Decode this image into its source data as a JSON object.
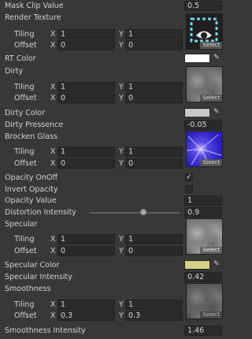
{
  "mask_clip": {
    "label": "Mask Clip Value",
    "value": "0.5"
  },
  "render_texture": {
    "label": "Render Texture",
    "tiling": {
      "label": "Tiling",
      "x": "1",
      "y": "1"
    },
    "offset": {
      "label": "Offset",
      "x": "0",
      "y": "0"
    },
    "select": "Select"
  },
  "rt_color": {
    "label": "RT Color",
    "color": "#ffffff"
  },
  "dirty": {
    "label": "Dirty",
    "tiling": {
      "label": "Tiling",
      "x": "1",
      "y": "1"
    },
    "offset": {
      "label": "Offset",
      "x": "0",
      "y": "0"
    },
    "select": "Select"
  },
  "dirty_color": {
    "label": "Dirty Color",
    "color": "#c8c8c8"
  },
  "dirty_presence": {
    "label": "Dirty Pressence",
    "value": "-0.05"
  },
  "broken_glass": {
    "label": "Brocken Glass",
    "tiling": {
      "label": "Tiling",
      "x": "1",
      "y": "1"
    },
    "offset": {
      "label": "Offset",
      "x": "0",
      "y": "0"
    },
    "select": "Select"
  },
  "opacity_onoff": {
    "label": "Opacity OnOff",
    "checked": true,
    "mark": "✓"
  },
  "invert_opacity": {
    "label": "Invert Opacity",
    "checked": false
  },
  "opacity_value": {
    "label": "Opacity Value",
    "value": "1"
  },
  "distortion": {
    "label": "Distortion Intensity",
    "value": "0.9",
    "slider_fraction": 0.6
  },
  "specular": {
    "label": "Specular",
    "tiling": {
      "label": "Tiling",
      "x": "1",
      "y": "1"
    },
    "offset": {
      "label": "Offset",
      "x": "0",
      "y": "0"
    },
    "select": "Select"
  },
  "specular_color": {
    "label": "Specular Color",
    "color": "#d8cf86"
  },
  "specular_intensity": {
    "label": "Specular Intensity",
    "value": "0.42"
  },
  "smoothness": {
    "label": "Smoothness",
    "tiling": {
      "label": "Tiling",
      "x": "1",
      "y": "1"
    },
    "offset": {
      "label": "Offset",
      "x": "0.3",
      "y": "0.3"
    },
    "select": "Select"
  },
  "smoothness_intensity": {
    "label": "Smoothness Intensity",
    "value": "1.46"
  },
  "axis": {
    "x": "X",
    "y": "Y"
  },
  "icons": {
    "picker": "eyedropper-icon",
    "render_texture_thumb": "render-texture-icon"
  }
}
